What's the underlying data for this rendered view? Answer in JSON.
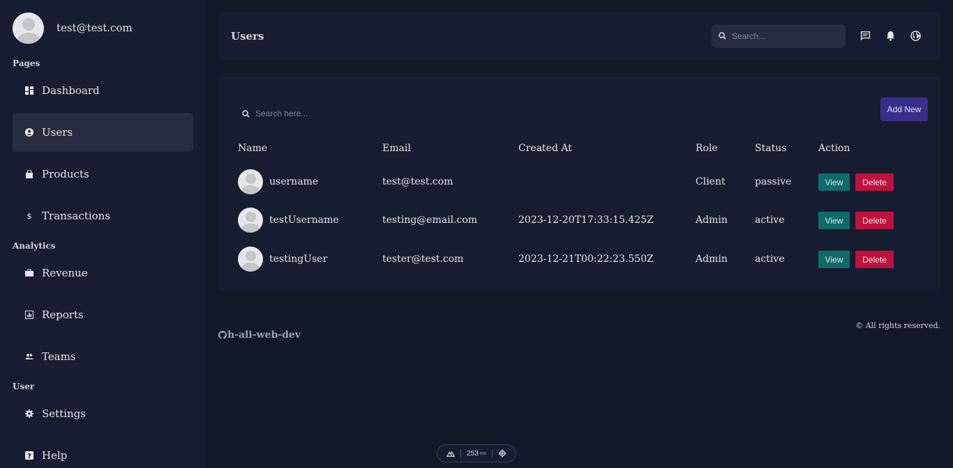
{
  "user": {
    "email": "test@test.com"
  },
  "sidebar": {
    "sections": [
      {
        "title": "Pages"
      },
      {
        "title": "Analytics"
      },
      {
        "title": "User"
      }
    ],
    "items": [
      {
        "label": "Dashboard",
        "icon": "dashboard-icon"
      },
      {
        "label": "Users",
        "icon": "user-circle-icon",
        "active": true
      },
      {
        "label": "Products",
        "icon": "shopping-bag-icon"
      },
      {
        "label": "Transactions",
        "icon": "dollar-icon"
      },
      {
        "label": "Revenue",
        "icon": "briefcase-icon"
      },
      {
        "label": "Reports",
        "icon": "bar-chart-icon"
      },
      {
        "label": "Teams",
        "icon": "people-icon"
      },
      {
        "label": "Settings",
        "icon": "gear-icon"
      },
      {
        "label": "Help",
        "icon": "help-icon"
      }
    ]
  },
  "header": {
    "title": "Users",
    "search_placeholder": "Search...",
    "icons": [
      "chat-icon",
      "bell-icon",
      "globe-icon"
    ]
  },
  "table": {
    "search_placeholder": "Search here...",
    "add_new_label": "Add New",
    "columns": [
      "Name",
      "Email",
      "Created At",
      "Role",
      "Status",
      "Action"
    ],
    "rows": [
      {
        "name": "username",
        "email": "test@test.com",
        "created_at": "",
        "role": "Client",
        "status": "passive",
        "view": "View",
        "delete": "Delete"
      },
      {
        "name": "testUsername",
        "email": "testing@email.com",
        "created_at": "2023-12-20T17:33:15.425Z",
        "role": "Admin",
        "status": "active",
        "view": "View",
        "delete": "Delete"
      },
      {
        "name": "testingUser",
        "email": "tester@test.com",
        "created_at": "2023-12-21T00:22:23.550Z",
        "role": "Admin",
        "status": "active",
        "view": "View",
        "delete": "Delete"
      }
    ]
  },
  "footer": {
    "brand": "h-ali-web-dev",
    "rights": "© All rights reserved."
  },
  "dev_badge": {
    "time": "253",
    "unit": "ms"
  },
  "colors": {
    "background": "#111827",
    "panel": "#161d31",
    "active_item": "#262d3e",
    "add_new": "#362f8a",
    "view": "#0f6b69",
    "delete": "#be123c"
  }
}
